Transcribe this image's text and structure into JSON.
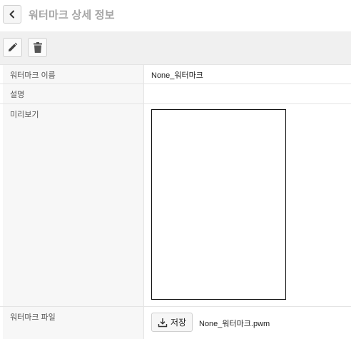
{
  "header": {
    "title": "워터마크 상세 정보",
    "back_icon": "chevron-left-icon"
  },
  "toolbar": {
    "edit_icon": "pencil-icon",
    "delete_icon": "trash-icon"
  },
  "details": {
    "rows": [
      {
        "label": "워터마크 이름",
        "value": "None_워터마크"
      },
      {
        "label": "설명",
        "value": ""
      },
      {
        "label": "미리보기",
        "value": ""
      },
      {
        "label": "워터마크 파일",
        "value": "None_워터마크.pwm"
      }
    ],
    "save_label": "저장",
    "save_icon": "download-icon"
  },
  "colors": {
    "title": "#a5a5a5",
    "toolbar_bg": "#f0f0f0",
    "label_bg": "#f7f7f7",
    "border": "#e4e4e4"
  }
}
